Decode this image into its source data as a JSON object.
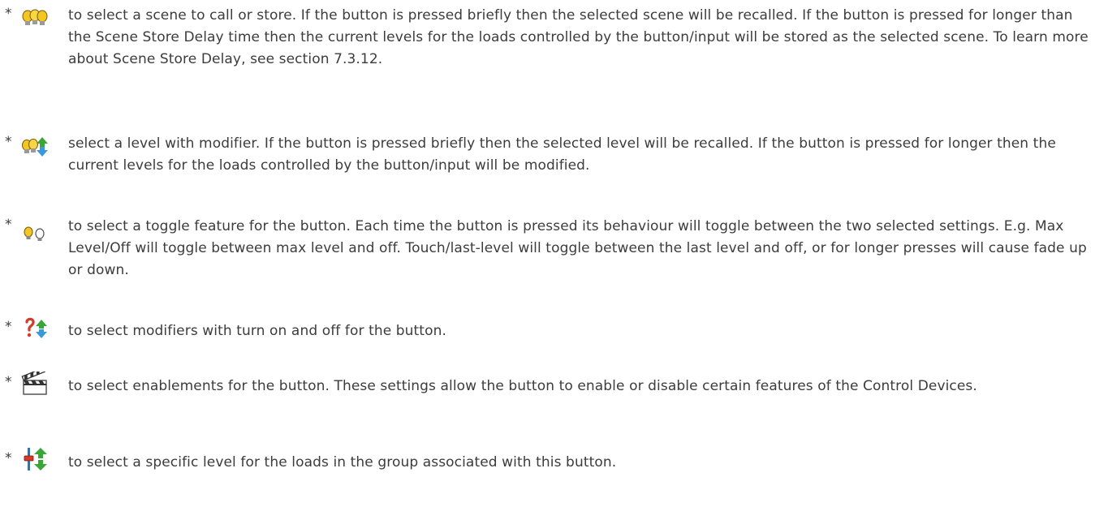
{
  "items": [
    {
      "bullet": "*",
      "icon": "scene-icon",
      "text": "to select a scene to call or store. If the button is pressed briefly then the selected scene will be recalled. If the button is pressed for longer than the Scene Store Delay time then the current levels for the loads controlled by the button/input will be stored as the selected scene. To learn more about Scene Store Delay, see section 7.3.12."
    },
    {
      "bullet": "*",
      "icon": "level-modifier-icon",
      "text": "select a level with modifier. If the button is pressed briefly then the selected level will be recalled. If the button is pressed for longer then the current levels for the loads controlled by the button/input will be modified."
    },
    {
      "bullet": "*",
      "icon": "toggle-bulbs-icon",
      "text": "to select a toggle feature for the button. Each time the button is pressed its behaviour will toggle between the two selected settings. E.g. Max Level/Off will toggle between max level and off. Touch/last-level will toggle between the last level and off, or for longer presses  will cause fade up or down."
    },
    {
      "bullet": "*",
      "icon": "modifier-on-off-icon",
      "text": "to select modifiers with turn on and off for the button."
    },
    {
      "bullet": "*",
      "icon": "clapperboard-icon",
      "text": "to select enablements for the button. These settings allow the button to enable or disable certain features of the Control Devices."
    },
    {
      "bullet": "*",
      "icon": "level-slider-icon",
      "text": "to select a specific level for the loads in the group associated with this button."
    }
  ],
  "colors": {
    "text": "#3c3c3c",
    "bulb_yellow": "#f3c623",
    "arrow_blue": "#3a9ad9",
    "arrow_green": "#3aa63a",
    "hook_red": "#d23a2a"
  }
}
